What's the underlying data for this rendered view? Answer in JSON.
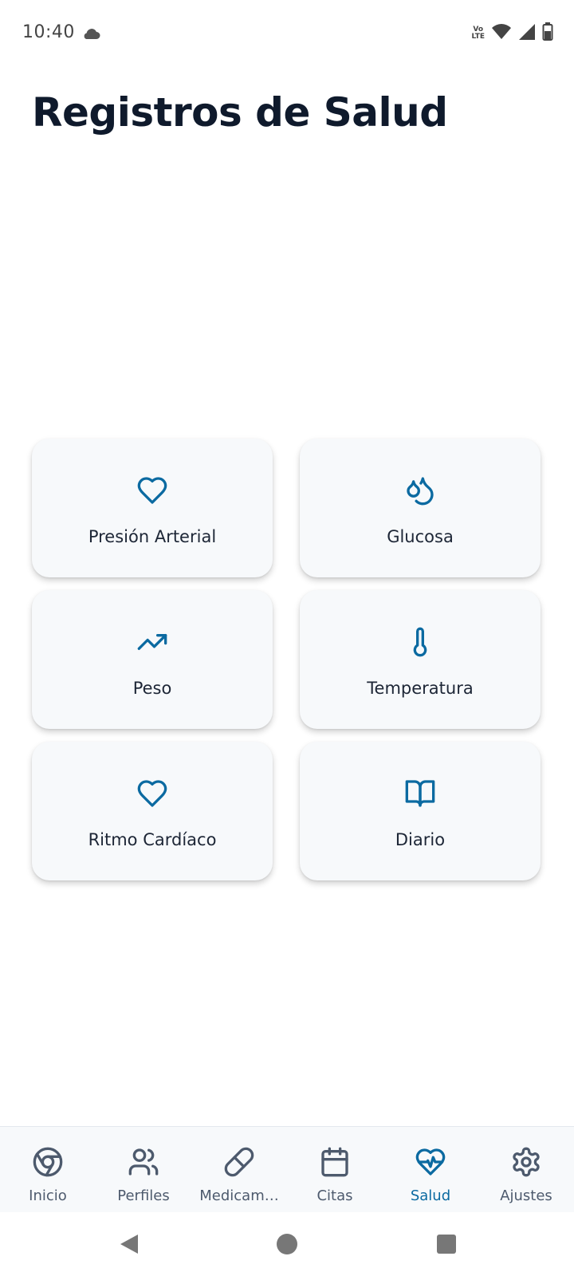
{
  "status_bar": {
    "time": "10:40",
    "icons": [
      "cloud-icon",
      "volte-icon",
      "wifi-icon",
      "signal-icon",
      "battery-icon"
    ],
    "volte_top": "Vo",
    "volte_bottom": "LTE"
  },
  "page": {
    "title": "Registros de Salud"
  },
  "colors": {
    "accent": "#0b6aa1",
    "title": "#0f1a2c",
    "card_bg": "#f7f9fb",
    "nav_inactive": "#4d5a6d"
  },
  "cards": [
    {
      "label": "Presión Arterial",
      "icon": "heart-icon"
    },
    {
      "label": "Glucosa",
      "icon": "droplets-icon"
    },
    {
      "label": "Peso",
      "icon": "trending-up-icon"
    },
    {
      "label": "Temperatura",
      "icon": "thermometer-icon"
    },
    {
      "label": "Ritmo Cardíaco",
      "icon": "heart-icon"
    },
    {
      "label": "Diario",
      "icon": "book-open-icon"
    }
  ],
  "bottom_nav": [
    {
      "label": "Inicio",
      "icon": "chrome-icon",
      "active": false
    },
    {
      "label": "Perfiles",
      "icon": "users-icon",
      "active": false
    },
    {
      "label": "Medicam…",
      "icon": "pill-icon",
      "active": false
    },
    {
      "label": "Citas",
      "icon": "calendar-icon",
      "active": false
    },
    {
      "label": "Salud",
      "icon": "heart-pulse-icon",
      "active": true
    },
    {
      "label": "Ajustes",
      "icon": "settings-icon",
      "active": false
    }
  ],
  "system_nav": [
    "back-icon",
    "home-icon",
    "recents-icon"
  ]
}
